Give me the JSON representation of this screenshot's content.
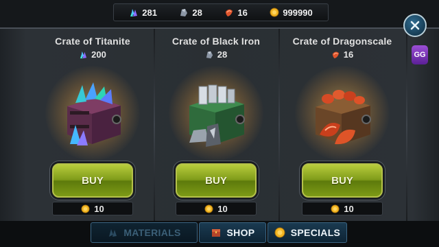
{
  "resources": [
    {
      "icon": "titanite-icon",
      "value": "281"
    },
    {
      "icon": "black-iron-icon",
      "value": "28"
    },
    {
      "icon": "dragonscale-icon",
      "value": "16"
    },
    {
      "icon": "gold-coin-icon",
      "value": "999990"
    }
  ],
  "crates": [
    {
      "title": "Crate of Titanite",
      "cost_icon": "titanite-icon",
      "amount": "200",
      "buy_label": "BUY",
      "price": "10"
    },
    {
      "title": "Crate of Black Iron",
      "cost_icon": "black-iron-icon",
      "amount": "28",
      "buy_label": "BUY",
      "price": "10"
    },
    {
      "title": "Crate of Dragonscale",
      "cost_icon": "dragonscale-icon",
      "amount": "16",
      "buy_label": "BUY",
      "price": "10"
    }
  ],
  "tabs": {
    "materials": "MATERIALS",
    "shop": "SHOP",
    "specials": "SPECIALS"
  },
  "overlay": {
    "gg_label": "GG"
  },
  "colors": {
    "buy_green": "#7f9b1a",
    "tab_blue": "#1a3a51",
    "gold": "#f2b623",
    "titanite": "#4fb3ff",
    "dragonscale": "#d9482b"
  }
}
